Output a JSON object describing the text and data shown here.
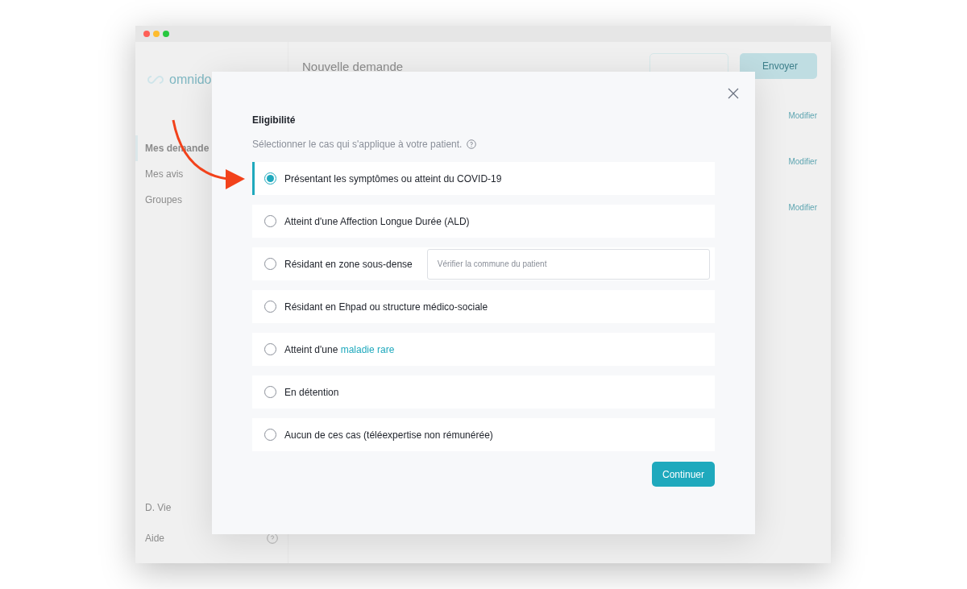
{
  "window": {
    "controls": [
      {
        "color": "#fe5f57"
      },
      {
        "color": "#febc2e"
      },
      {
        "color": "#28c840"
      }
    ]
  },
  "sidebar": {
    "logo": "omnido",
    "items": [
      {
        "label": "Mes demande",
        "selected": true
      },
      {
        "label": "Mes avis",
        "selected": false
      },
      {
        "label": "Groupes",
        "selected": false
      }
    ],
    "user": "D. Vie",
    "help": "Aide"
  },
  "main": {
    "title": "Nouvelle demande",
    "send_button": "Envoyer",
    "links": [
      "Modifier",
      "Modifier",
      "Modifier"
    ]
  },
  "dialog": {
    "title": "Eligibilité",
    "subtitle": "Sélectionner le cas qui s'applique à votre patient.",
    "options": [
      {
        "kind": "plain",
        "label": "Présentant les symptômes ou atteint du COVID-19",
        "selected": true
      },
      {
        "kind": "plain",
        "label": "Atteint d'une Affection Longue Durée (ALD)",
        "selected": false
      },
      {
        "kind": "field",
        "label": "Résidant en zone sous-dense",
        "placeholder": "Vérifier la commune du patient",
        "selected": false
      },
      {
        "kind": "plain",
        "label": "Résidant en Ehpad ou structure médico-sociale",
        "selected": false
      },
      {
        "kind": "link",
        "label": "Atteint d'une",
        "link": "maladie rare",
        "selected": false
      },
      {
        "kind": "plain",
        "label": "En détention",
        "selected": false
      },
      {
        "kind": "plain",
        "label": "Aucun de ces cas (téléexpertise non rémunérée)",
        "selected": false
      }
    ],
    "continue_button": "Continuer"
  }
}
